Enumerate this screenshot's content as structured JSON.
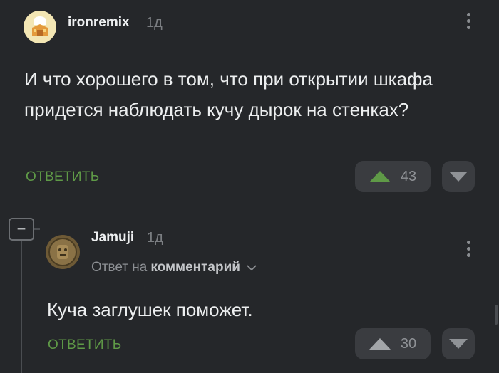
{
  "comment1": {
    "username": "ironremix",
    "time": "1д",
    "text": "И что хорошего в том, что при открытии шкафа придется наблюдать кучу дырок на стенках?",
    "reply_label": "ОТВЕТИТЬ",
    "rating": "43"
  },
  "comment2": {
    "collapse_symbol": "−",
    "username": "Jamuji",
    "time": "1д",
    "reply_to_prefix": "Ответ на",
    "reply_to_target": "комментарий",
    "text": "Куча заглушек поможет.",
    "reply_label": "ОТВЕТИТЬ",
    "rating": "30"
  },
  "colors": {
    "background": "#25272a",
    "reply_green": "#5f9a47",
    "upvote_active": "#5f9a47",
    "button_bg": "#3a3c40"
  },
  "icons": [
    "avatar-chef",
    "avatar-coin",
    "kebab-menu-icon",
    "upvote-arrow-icon",
    "downvote-arrow-icon",
    "chevron-down-icon",
    "collapse-minus-icon"
  ]
}
